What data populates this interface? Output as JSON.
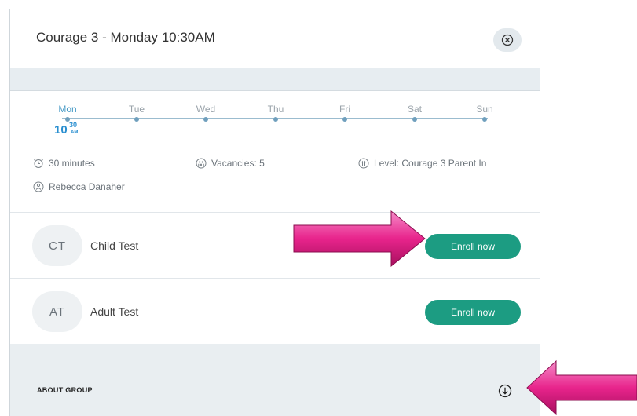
{
  "header": {
    "title": "Courage 3 - Monday 10:30AM"
  },
  "schedule": {
    "days": [
      {
        "label": "Mon",
        "active": true
      },
      {
        "label": "Tue",
        "active": false
      },
      {
        "label": "Wed",
        "active": false
      },
      {
        "label": "Thu",
        "active": false
      },
      {
        "label": "Fri",
        "active": false
      },
      {
        "label": "Sat",
        "active": false
      },
      {
        "label": "Sun",
        "active": false
      }
    ],
    "time": {
      "hour": "10",
      "minute": "30",
      "ampm": "AM"
    }
  },
  "details": {
    "duration": "30 minutes",
    "vacancies": "Vacancies: 5",
    "level": "Level: Courage 3 Parent In",
    "instructor": "Rebecca Danaher"
  },
  "participants": [
    {
      "initials": "CT",
      "name": "Child Test",
      "action": "Enroll now"
    },
    {
      "initials": "AT",
      "name": "Adult Test",
      "action": "Enroll now"
    }
  ],
  "about": {
    "label": "ABOUT GROUP"
  },
  "colors": {
    "accent": "#1c9c82",
    "highlight": "#2a8fd0",
    "annotation_arrow": "#e8248c"
  }
}
